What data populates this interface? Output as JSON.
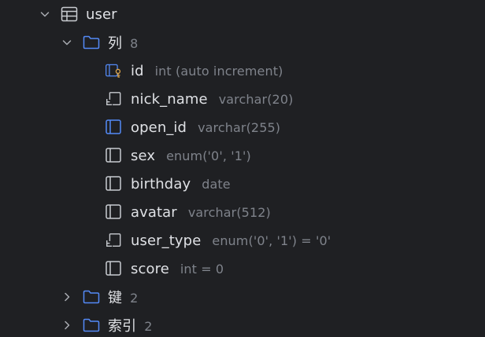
{
  "table": {
    "name": "user",
    "icon": "table-icon",
    "expanded": true
  },
  "columns_folder": {
    "label": "列",
    "count": "8",
    "icon": "folder-icon",
    "expanded": true
  },
  "columns": [
    {
      "name": "id",
      "type": "int (auto increment)",
      "icon": "primary-key-column-icon"
    },
    {
      "name": "nick_name",
      "type": "varchar(20)",
      "icon": "indexed-column-icon"
    },
    {
      "name": "open_id",
      "type": "varchar(255)",
      "icon": "unique-column-icon"
    },
    {
      "name": "sex",
      "type": "enum('0', '1')",
      "icon": "column-icon"
    },
    {
      "name": "birthday",
      "type": "date",
      "icon": "column-icon"
    },
    {
      "name": "avatar",
      "type": "varchar(512)",
      "icon": "column-icon"
    },
    {
      "name": "user_type",
      "type": "enum('0', '1') = '0'",
      "icon": "indexed-column-icon"
    },
    {
      "name": "score",
      "type": "int = 0",
      "icon": "column-icon"
    }
  ],
  "keys_folder": {
    "label": "键",
    "count": "2",
    "icon": "folder-icon",
    "expanded": false
  },
  "indexes_folder": {
    "label": "索引",
    "count": "2",
    "icon": "folder-icon",
    "expanded": false
  },
  "colors": {
    "background": "#1f2023",
    "text": "#dfe1e5",
    "muted": "#7f838b",
    "accent_blue": "#548af7",
    "key_gold": "#e0a84c"
  }
}
